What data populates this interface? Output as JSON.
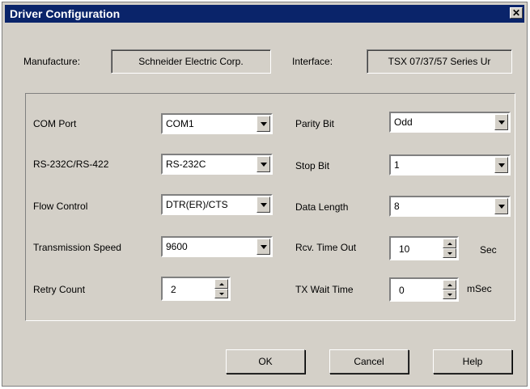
{
  "window": {
    "title": "Driver Configuration",
    "close_glyph": "✕"
  },
  "info": {
    "manufacture_label": "Manufacture:",
    "manufacture_value": "Schneider Electric Corp.",
    "interface_label": "Interface:",
    "interface_value": "TSX 07/37/57 Series Ur"
  },
  "settings": {
    "com_port": {
      "label": "COM Port",
      "value": "COM1"
    },
    "rs": {
      "label": "RS-232C/RS-422",
      "value": "RS-232C"
    },
    "flow": {
      "label": "Flow Control",
      "value": "DTR(ER)/CTS"
    },
    "speed": {
      "label": "Transmission Speed",
      "value": "9600"
    },
    "retry": {
      "label": "Retry Count",
      "value": "2"
    },
    "parity": {
      "label": "Parity Bit",
      "value": "Odd"
    },
    "stop": {
      "label": "Stop Bit",
      "value": "1"
    },
    "data_length": {
      "label": "Data Length",
      "value": "8"
    },
    "rcv_timeout": {
      "label": "Rcv. Time Out",
      "value": "10",
      "unit": "Sec"
    },
    "tx_wait": {
      "label": "TX Wait Time",
      "value": "0",
      "unit": "mSec"
    }
  },
  "buttons": {
    "ok": "OK",
    "cancel": "Cancel",
    "help": "Help"
  }
}
